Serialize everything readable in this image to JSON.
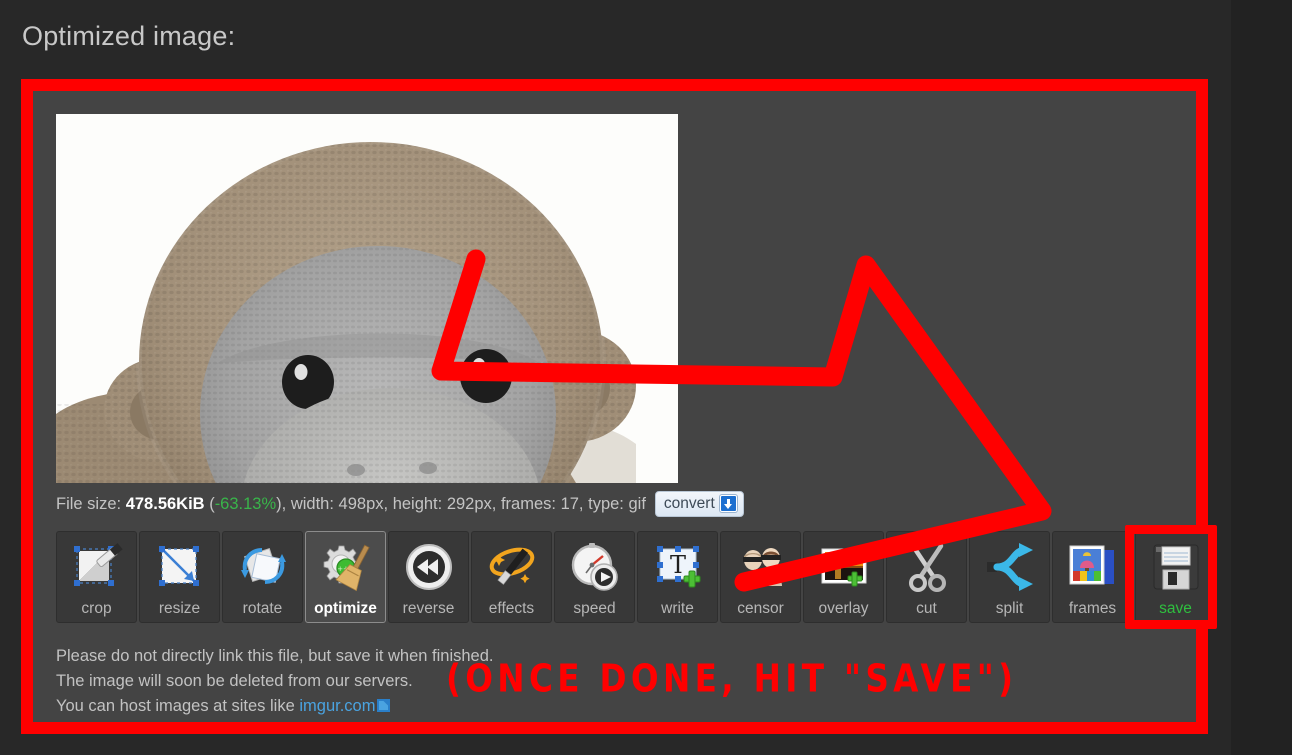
{
  "page": {
    "title": "Optimized image:",
    "background_color": "#282828",
    "panel_color": "#444444",
    "highlight_color": "#ff0000"
  },
  "preview": {
    "alt": "knitted monkey toy close-up",
    "image_background": "#fdfdfb"
  },
  "file_info": {
    "size_label": "File size:",
    "size_value": "478.56KiB",
    "open_paren": "(",
    "percent_change": "-63.13%",
    "close_paren": "),",
    "width_label": "width:",
    "width_value": "498px,",
    "height_label": "height:",
    "height_value": "292px,",
    "frames_label": "frames:",
    "frames_value": "17,",
    "type_label": "type:",
    "type_value": "gif",
    "convert_label": "convert",
    "convert_icon": "download-arrow-icon",
    "percent_color": "#39b54a"
  },
  "toolbar": {
    "items": [
      {
        "label": "crop",
        "icon": "crop-icon",
        "active": false
      },
      {
        "label": "resize",
        "icon": "resize-icon",
        "active": false
      },
      {
        "label": "rotate",
        "icon": "rotate-icon",
        "active": false
      },
      {
        "label": "optimize",
        "icon": "optimize-icon",
        "active": true
      },
      {
        "label": "reverse",
        "icon": "reverse-icon",
        "active": false
      },
      {
        "label": "effects",
        "icon": "effects-icon",
        "active": false
      },
      {
        "label": "speed",
        "icon": "speed-icon",
        "active": false
      },
      {
        "label": "write",
        "icon": "write-icon",
        "active": false
      },
      {
        "label": "censor",
        "icon": "censor-icon",
        "active": false
      },
      {
        "label": "overlay",
        "icon": "overlay-icon",
        "active": false
      },
      {
        "label": "cut",
        "icon": "cut-icon",
        "active": false
      },
      {
        "label": "split",
        "icon": "split-icon",
        "active": false
      },
      {
        "label": "frames",
        "icon": "frames-icon",
        "active": false
      },
      {
        "label": "save",
        "icon": "save-floppy-icon",
        "active": false,
        "highlight": true,
        "label_color": "#2fbf3f"
      }
    ]
  },
  "notes": {
    "line1": "Please do not directly link this file, but save it when finished.",
    "line2": "The image will soon be deleted from our servers.",
    "line3_prefix": "You can host images at sites like ",
    "link_text": "imgur.com",
    "link_icon": "external-link-icon"
  },
  "annotations": {
    "callout_text": "(ONCE DONE, HIT \"SAVE\")",
    "arrow": "hand-drawn-arrow-pointing-to-save",
    "color": "#ff0000"
  }
}
